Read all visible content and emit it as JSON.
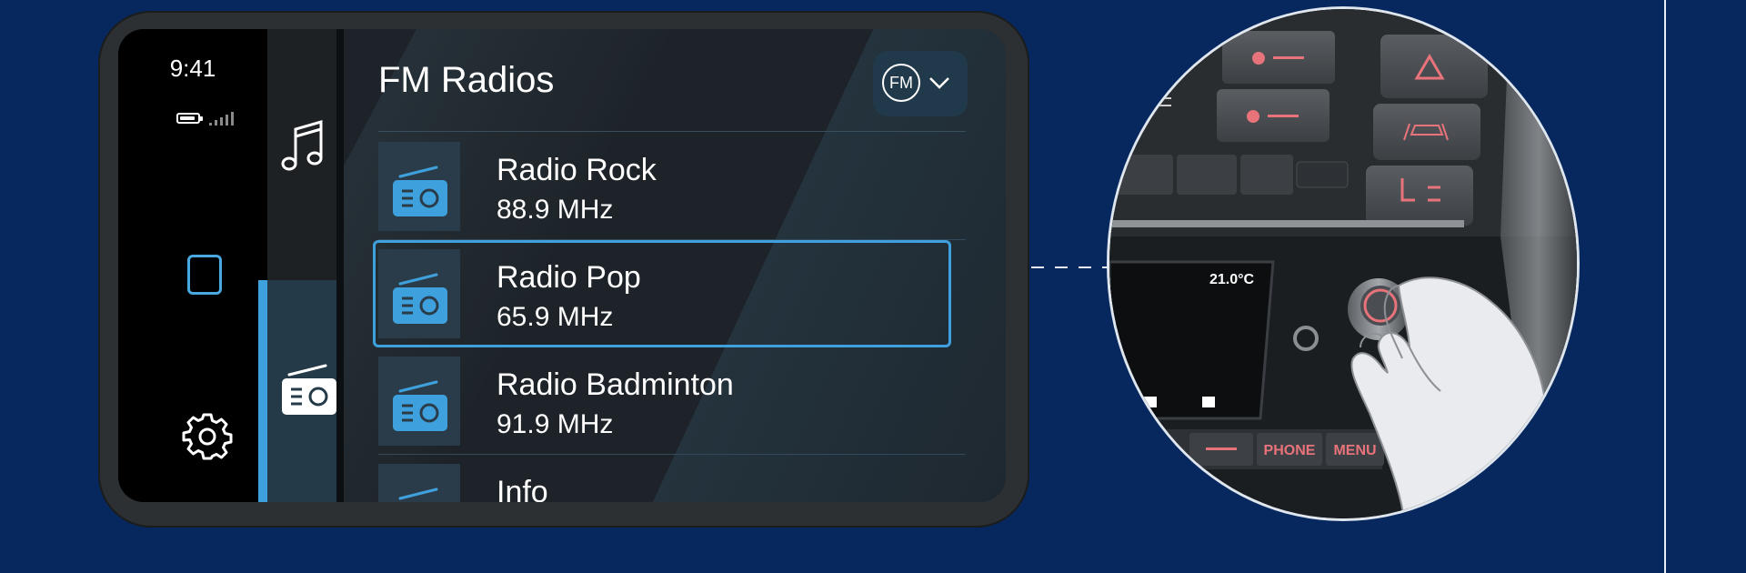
{
  "status": {
    "time": "9:41"
  },
  "header": {
    "title": "FM Radios",
    "band_button": "FM"
  },
  "stations": [
    {
      "name": "Radio Rock",
      "frequency": "88.9 MHz"
    },
    {
      "name": "Radio Pop",
      "frequency": "65.9 MHz",
      "selected": true
    },
    {
      "name": "Radio Badminton",
      "frequency": "91.9 MHz"
    },
    {
      "name": "Info",
      "frequency": ""
    }
  ],
  "dashboard": {
    "temperature": "21.0°C",
    "phone_button": "PHONE",
    "menu_button": "MENU"
  },
  "colors": {
    "background": "#06285e",
    "accent": "#3ea1dd",
    "dash_button_text": "#e8737a"
  },
  "icons": [
    "battery-icon",
    "signal-icon",
    "home-square-icon",
    "gear-icon",
    "music-note-icon",
    "radio-icon",
    "chevron-down-icon",
    "chevron-left-icon",
    "fan-icon",
    "hazard-icon",
    "lane-assist-icon",
    "seat-heat-icon"
  ]
}
